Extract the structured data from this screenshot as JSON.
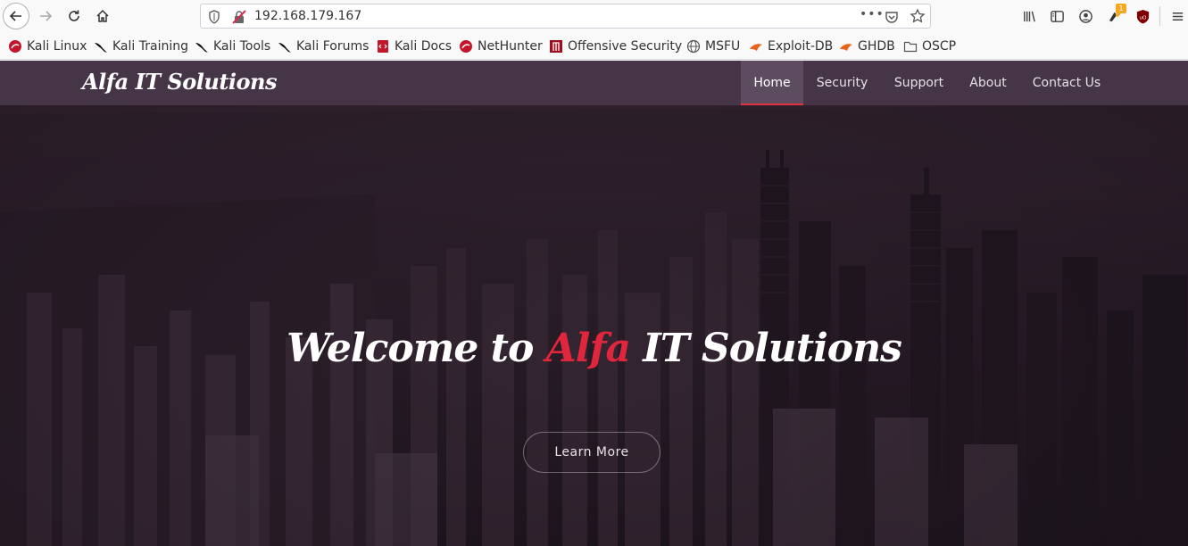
{
  "browser": {
    "url": "192.168.179.167",
    "url_more": "•••",
    "notification_badge": "1",
    "icons": [
      "back-icon",
      "forward-icon",
      "reload-icon",
      "home-icon",
      "shield-icon",
      "insecure-lock-icon",
      "page-actions-icon",
      "pocket-icon",
      "bookmark-star-icon",
      "library-icon",
      "sidebar-icon",
      "account-icon",
      "extension-icon",
      "ublock-icon",
      "menu-icon"
    ]
  },
  "bookmarks": [
    {
      "label": "Kali Linux",
      "icon": "kali-icon"
    },
    {
      "label": "Kali Training",
      "icon": "kali-dragon-icon"
    },
    {
      "label": "Kali Tools",
      "icon": "kali-dragon-icon"
    },
    {
      "label": "Kali Forums",
      "icon": "kali-dragon-icon"
    },
    {
      "label": "Kali Docs",
      "icon": "docs-icon"
    },
    {
      "label": "NetHunter",
      "icon": "kali-icon"
    },
    {
      "label": "Offensive Security",
      "icon": "offsec-icon"
    },
    {
      "label": "MSFU",
      "icon": "globe-icon"
    },
    {
      "label": "Exploit-DB",
      "icon": "exploitdb-icon"
    },
    {
      "label": "GHDB",
      "icon": "exploitdb-icon"
    },
    {
      "label": "OSCP",
      "icon": "folder-icon"
    }
  ],
  "site": {
    "brand": "Alfa IT Solutions",
    "menu": [
      {
        "label": "Home",
        "active": true
      },
      {
        "label": "Security",
        "active": false
      },
      {
        "label": "Support",
        "active": false
      },
      {
        "label": "About",
        "active": false
      },
      {
        "label": "Contact Us",
        "active": false
      }
    ],
    "hero": {
      "headline_prefix": "Welcome to ",
      "headline_accent": "Alfa",
      "headline_suffix": " IT Solutions",
      "button_label": "Learn More"
    }
  },
  "colors": {
    "accent": "#e0263c",
    "nav_background": "#48374a",
    "active_tab": "#5d4b5f"
  }
}
